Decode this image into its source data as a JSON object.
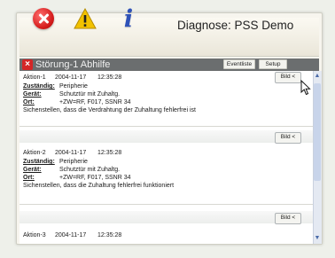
{
  "window": {
    "title": "Diagnose: PSS Demo"
  },
  "toolbar": {
    "buttons": [
      {
        "name": "error-icon"
      },
      {
        "name": "warning-icon"
      },
      {
        "name": "info-icon"
      }
    ]
  },
  "header": {
    "title": "Störung-1 Abhilfe",
    "buttons": [
      "Eventliste",
      "Setup"
    ]
  },
  "entries": [
    {
      "id": "Aktion-1",
      "date": "2004-11-17",
      "time": "12:35:28",
      "fields": [
        {
          "label": "Zuständig:",
          "value": "Peripherie"
        },
        {
          "label": "Gerät:",
          "value": "Schutztür mit Zuhaltg."
        },
        {
          "label": "Ort:",
          "value": "+ZW=RF, F017, SSNR 34"
        }
      ],
      "description": "Sichenstellen, dass die Verdrahtung der Zuhaltung fehlerfrei ist",
      "button": "Bild <"
    },
    {
      "id": "Aktion-2",
      "date": "2004-11-17",
      "time": "12:35:28",
      "fields": [
        {
          "label": "Zuständig:",
          "value": "Peripherie"
        },
        {
          "label": "Gerät:",
          "value": "Schutztür mit Zuhaltg."
        },
        {
          "label": "Ort:",
          "value": "+ZW=RF, F017, SSNR 34"
        }
      ],
      "description": "Sichenstellen, dass die Zuhaltung fehlerfrei funktioniert",
      "button": "Bild <"
    },
    {
      "id": "Aktion-3",
      "date": "2004-11-17",
      "time": "12:35:28",
      "button": "Bild <"
    }
  ],
  "colors": {
    "header_bar": "#6b6e6f",
    "error_red": "#d42626",
    "info_blue": "#2f52b8",
    "warning_yellow": "#f2c200"
  }
}
